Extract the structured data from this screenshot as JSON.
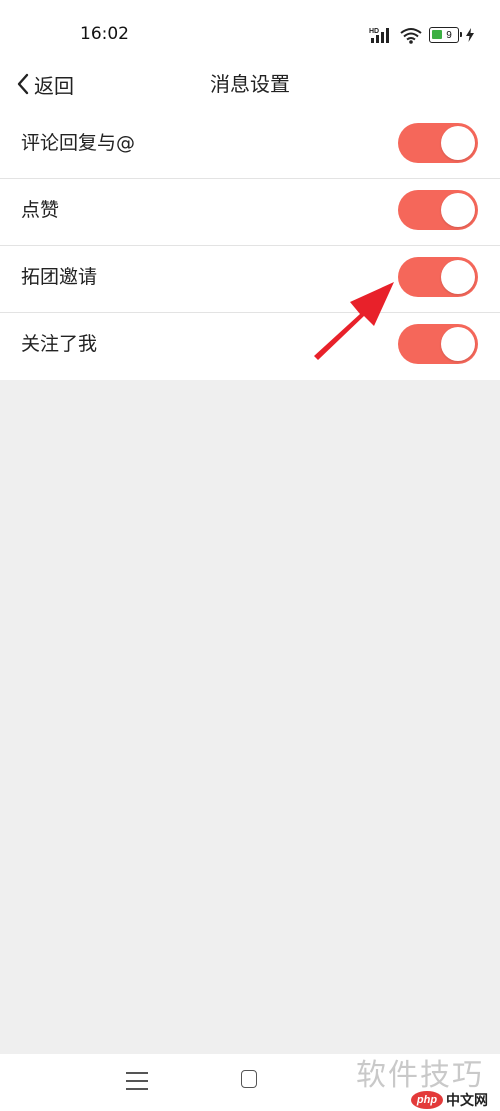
{
  "status_bar": {
    "time": "16:02",
    "network_label": "HD",
    "battery_level": "9",
    "icons": [
      "hd-signal-icon",
      "wifi-icon",
      "battery-icon",
      "charging-icon"
    ],
    "battery_color": "#3cb043"
  },
  "nav": {
    "back_label": "返回",
    "title": "消息设置",
    "back_icon": "chevron-left-icon"
  },
  "settings": [
    {
      "label": "评论回复与@",
      "enabled": true
    },
    {
      "label": "点赞",
      "enabled": true
    },
    {
      "label": "拓团邀请",
      "enabled": true
    },
    {
      "label": "关注了我",
      "enabled": true
    }
  ],
  "toggle_on_color": "#f5675a",
  "annotation": {
    "icon": "red-arrow-icon",
    "color": "#e8212a",
    "points_to": "拓团邀请"
  },
  "bottom_nav": {
    "icons": [
      "menu-icon",
      "home-icon"
    ]
  },
  "watermark": {
    "text": "软件技巧",
    "badge_logo": "php",
    "badge_text": "中文网"
  }
}
